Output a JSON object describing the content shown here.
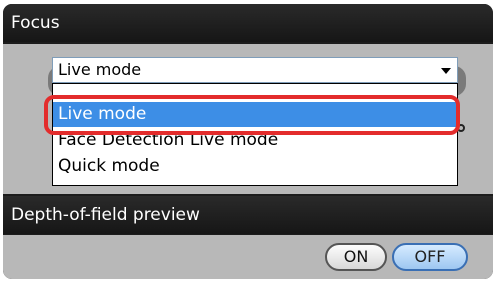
{
  "focus_section": {
    "title": "Focus",
    "select": {
      "value": "Live mode",
      "options": [
        "Live mode",
        "Face Detection Live mode",
        "Quick mode"
      ],
      "selected_index": 0
    }
  },
  "dof_section": {
    "title": "Depth-of-field preview",
    "on_label": "ON",
    "off_label": "OFF",
    "active": "OFF"
  },
  "colors": {
    "highlight_ring": "#e32c2c",
    "selected_item": "#3d8ee6",
    "panel_bg": "#1c1c1c"
  },
  "icons": {
    "dropdown_arrow": "chevron-down-icon"
  }
}
